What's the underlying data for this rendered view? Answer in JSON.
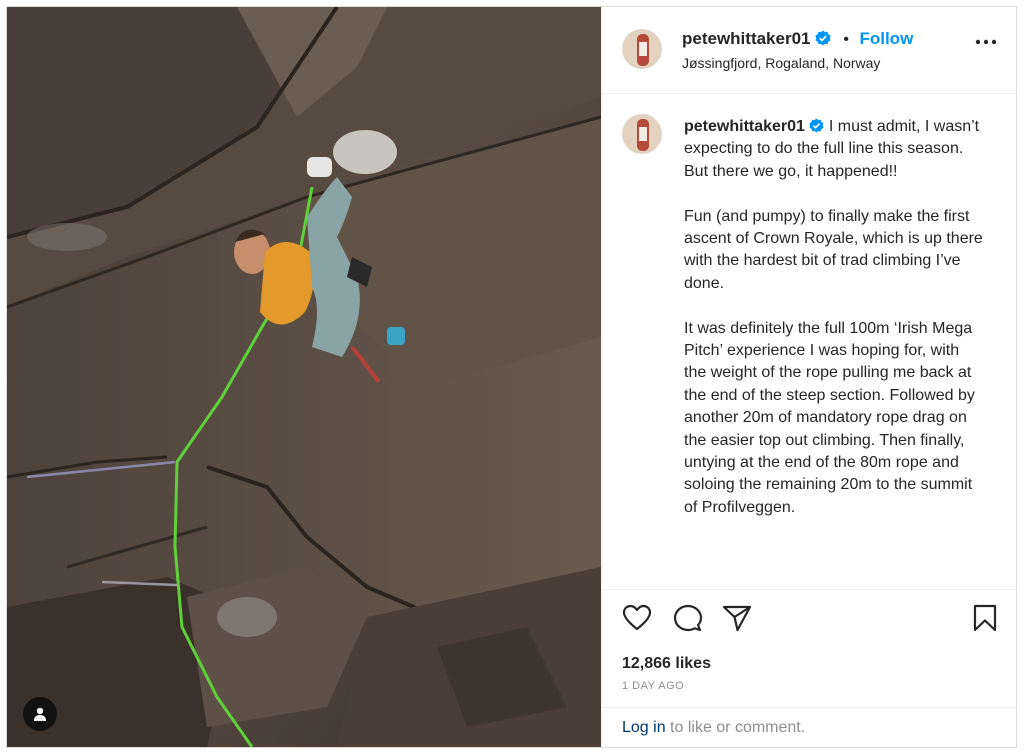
{
  "post": {
    "username": "petewhittaker01",
    "location": "Jøssingfjord, Rogaland, Norway",
    "follow_label": "Follow",
    "dot": "•"
  },
  "caption": {
    "username": "petewhittaker01",
    "intro": "I must admit, I wasn’t expecting to do the full line this season. But there we go, it happened!!",
    "paragraph2": "Fun (and pumpy) to finally make the first ascent of Crown Royale, which is up there with the hardest bit of trad climbing I’ve done.",
    "paragraph3": "It was definitely the full 100m ‘Irish Mega Pitch’ experience I was hoping for, with the weight of the rope pulling me back at the end of the steep section. Followed by another 20m of mandatory rope drag on the easier top out climbing. Then finally, untying at the end of the 80m rope and soloing the remaining 20m to the summit of Profilveggen."
  },
  "stats": {
    "likes": "12,866 likes",
    "date": "1 DAY AGO"
  },
  "footer": {
    "login_link": "Log in",
    "login_suffix": " to like or comment."
  },
  "icons": {
    "verified": "verified-badge-icon",
    "more": "more-options-icon",
    "like": "heart-icon",
    "comment": "comment-icon",
    "share": "paper-plane-icon",
    "save": "bookmark-icon",
    "user_tag": "user-tag-icon"
  },
  "colors": {
    "accent": "#0095f6",
    "link": "#00376b",
    "muted": "#8e8e8e",
    "rope": "#5fd13a"
  }
}
